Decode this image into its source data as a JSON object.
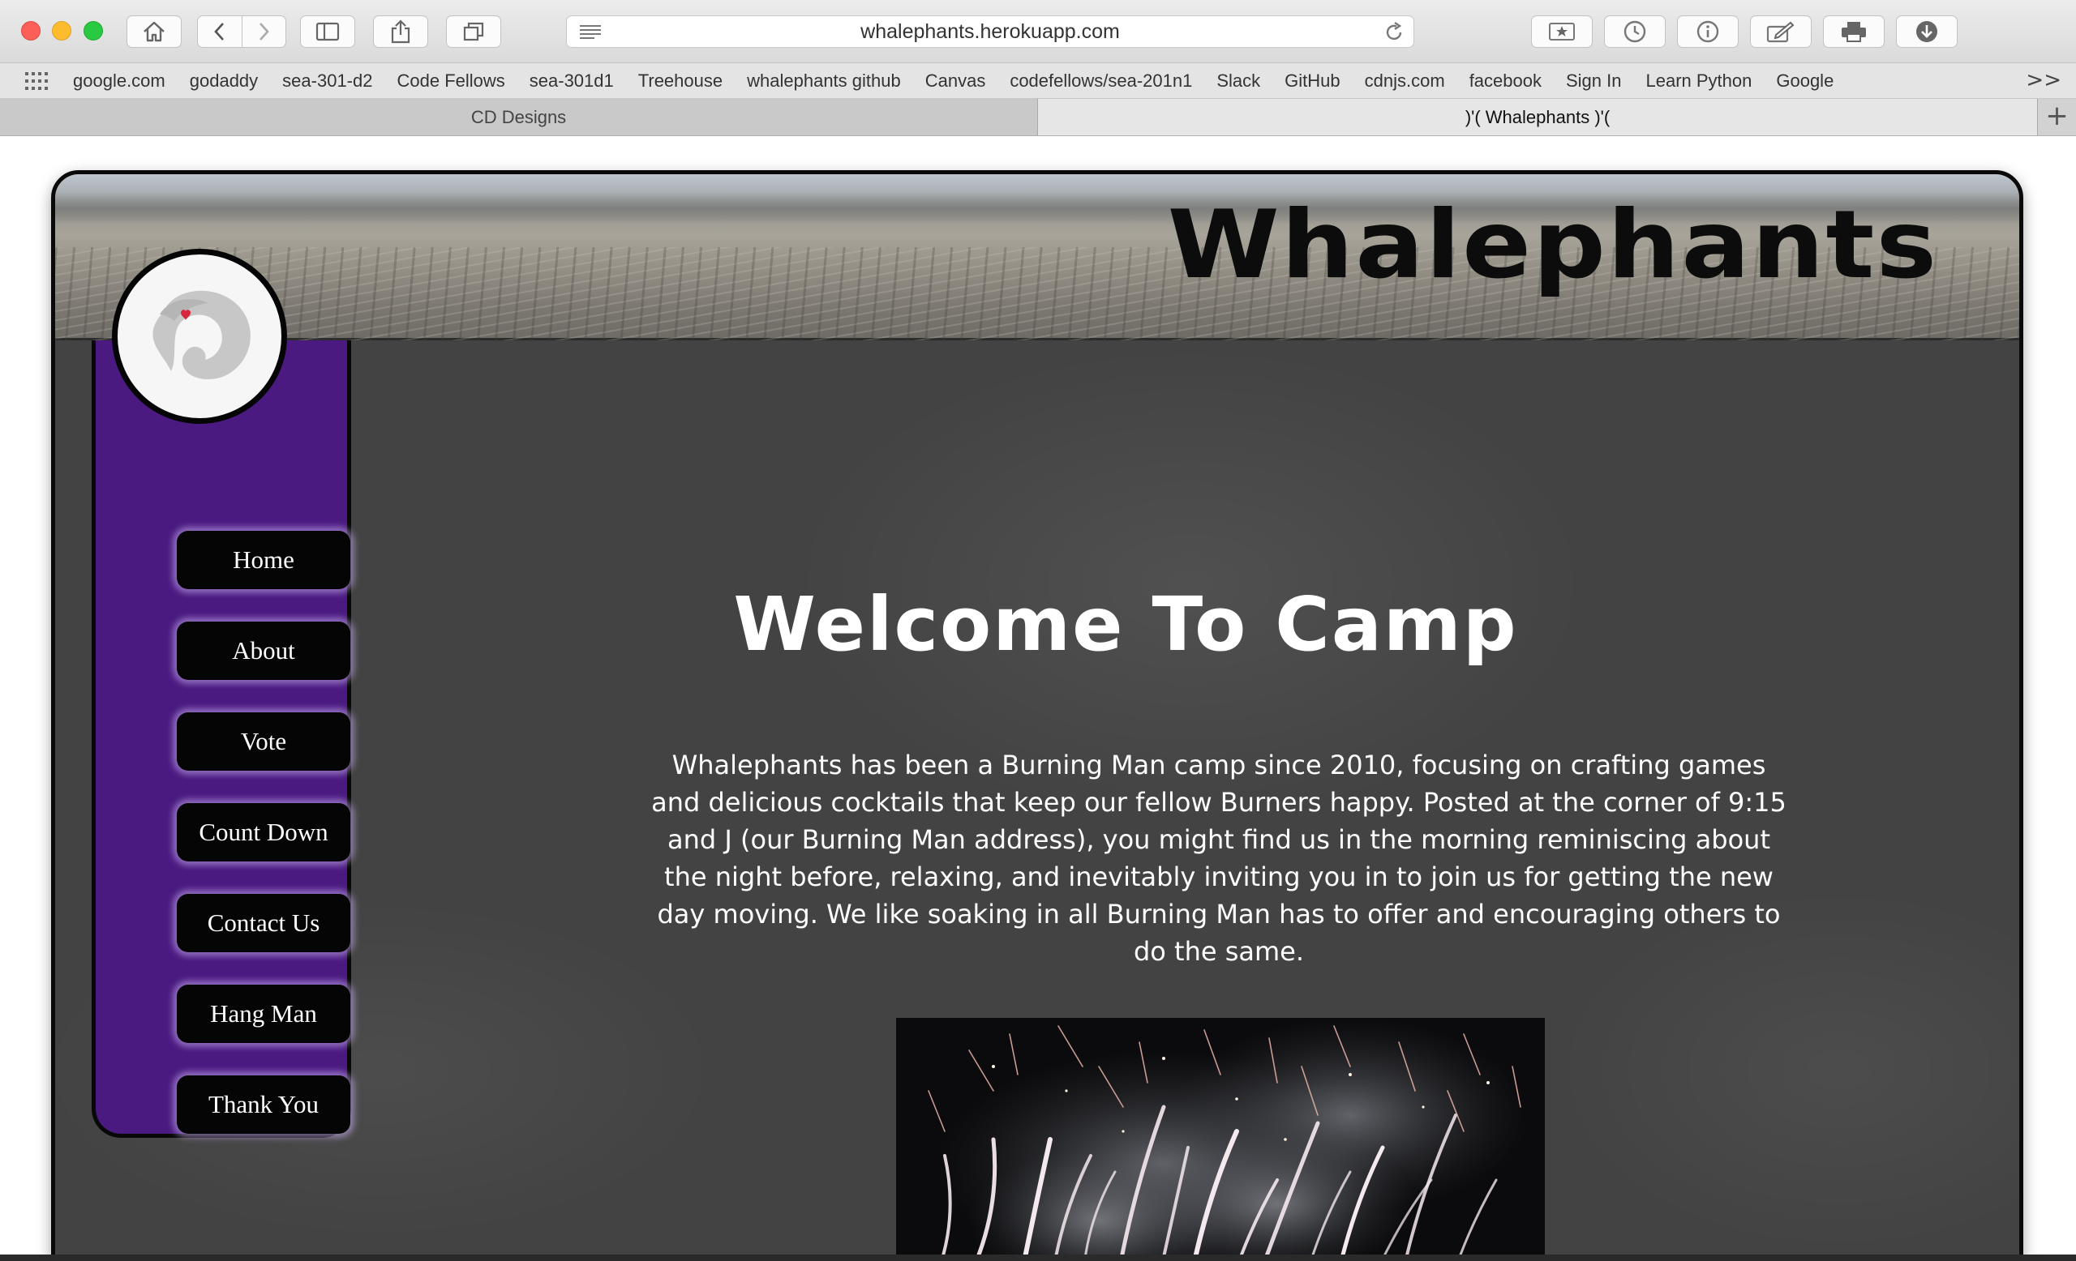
{
  "browser": {
    "url": "whalephants.herokuapp.com",
    "bookmarks": [
      "google.com",
      "godaddy",
      "sea-301-d2",
      "Code Fellows",
      "sea-301d1",
      "Treehouse",
      "whalephants github",
      "Canvas",
      "codefellows/sea-201n1",
      "Slack",
      "GitHub",
      "cdnjs.com",
      "facebook",
      "Sign In",
      "Learn Python",
      "Google"
    ],
    "bookmarks_more": ">>",
    "tabs": [
      {
        "title": "CD Designs",
        "active": false
      },
      {
        "title": ")'( Whalephants )'(",
        "active": true
      }
    ],
    "new_tab": "+"
  },
  "site": {
    "title": "Whalephants",
    "nav": [
      "Home",
      "About",
      "Vote",
      "Count Down",
      "Contact Us",
      "Hang Man",
      "Thank You"
    ],
    "heading": "Welcome To Camp",
    "intro": "Whalephants has been a Burning Man camp since 2010, focusing on crafting games and delicious cocktails that keep our fellow Burners happy. Posted at the corner of 9:15 and J (our Burning Man address), you might find us in the morning reminiscing about the night before, relaxing, and inevitably inviting you in to join us for getting the new day moving. We like soaking in all Burning Man has to offer and encouraging others to do the same."
  },
  "icons": [
    "home-icon",
    "back-icon",
    "forward-icon",
    "sidebar-icon",
    "share-icon",
    "tabs-icon",
    "reader-icon",
    "reload-icon",
    "bookmark-star-icon",
    "history-icon",
    "info-icon",
    "edit-icon",
    "print-icon",
    "download-icon",
    "apps-grid-icon"
  ],
  "colors": {
    "sidebar": "#4a1a80",
    "chalkboard": "#434343",
    "nav_button": "#050505",
    "nav_glow": "#c8aff0",
    "logo_heart": "#d9253c"
  }
}
